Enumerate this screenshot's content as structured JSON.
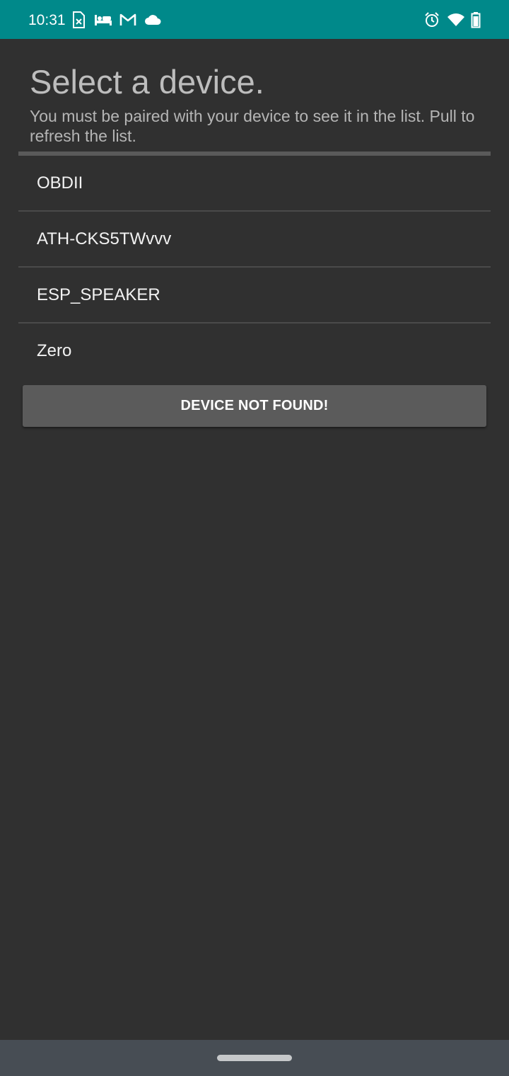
{
  "status_bar": {
    "time": "10:31",
    "left_icons": [
      "sim-card-icon",
      "hotel-bed-icon",
      "gmail-icon",
      "cloud-icon"
    ],
    "right_icons": [
      "alarm-icon",
      "wifi-icon",
      "battery-icon"
    ],
    "color": "#00898a"
  },
  "header": {
    "title": "Select a device.",
    "subtitle": "You must be paired with your device to see it in the list. Pull to refresh the list."
  },
  "devices": [
    {
      "label": "OBDII"
    },
    {
      "label": "ATH-CKS5TWvvv"
    },
    {
      "label": "ESP_SPEAKER"
    },
    {
      "label": "Zero"
    }
  ],
  "actions": {
    "not_found_label": "DEVICE NOT FOUND!"
  },
  "theme": {
    "background": "#303030",
    "button": "#5b5b5b",
    "nav_bar": "#474d54"
  }
}
